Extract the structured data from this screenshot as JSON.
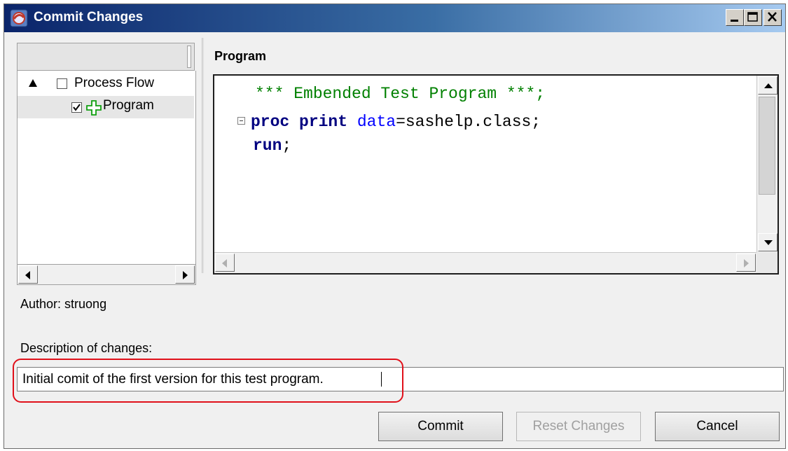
{
  "window": {
    "title": "Commit Changes",
    "icon": "sas-app-icon"
  },
  "tree": {
    "items": [
      {
        "label": "Process Flow",
        "checked": false,
        "expanded": true,
        "icon": "expander-triangle-icon"
      },
      {
        "label": "Program",
        "checked": true,
        "selected": true,
        "icon": "green-plus-add-icon"
      }
    ]
  },
  "editor": {
    "heading": "Program",
    "lines": [
      {
        "parts": [
          {
            "text": "*** Embended Test Program ***;",
            "color": "#008000",
            "bold": false
          }
        ]
      },
      {
        "parts": [
          {
            "text": "proc print",
            "color": "#000080",
            "bold": true
          },
          {
            "text": " ",
            "color": "#000000",
            "bold": false
          },
          {
            "text": "data",
            "color": "#0000ff",
            "bold": false
          },
          {
            "text": "=sashelp.class;",
            "color": "#000000",
            "bold": false
          }
        ]
      },
      {
        "parts": [
          {
            "text": "run",
            "color": "#000080",
            "bold": true
          },
          {
            "text": ";",
            "color": "#000000",
            "bold": false
          }
        ]
      }
    ]
  },
  "author": {
    "text": "Author: struong"
  },
  "description": {
    "label": "Description of changes:",
    "value": "Initial comit of the first version for this test program."
  },
  "buttons": {
    "commit": "Commit",
    "reset": "Reset Changes",
    "cancel": "Cancel"
  },
  "colors": {
    "highlight_border": "#e0101a",
    "title_gradient_start": "#0a246a",
    "title_gradient_end": "#a6caf0"
  }
}
